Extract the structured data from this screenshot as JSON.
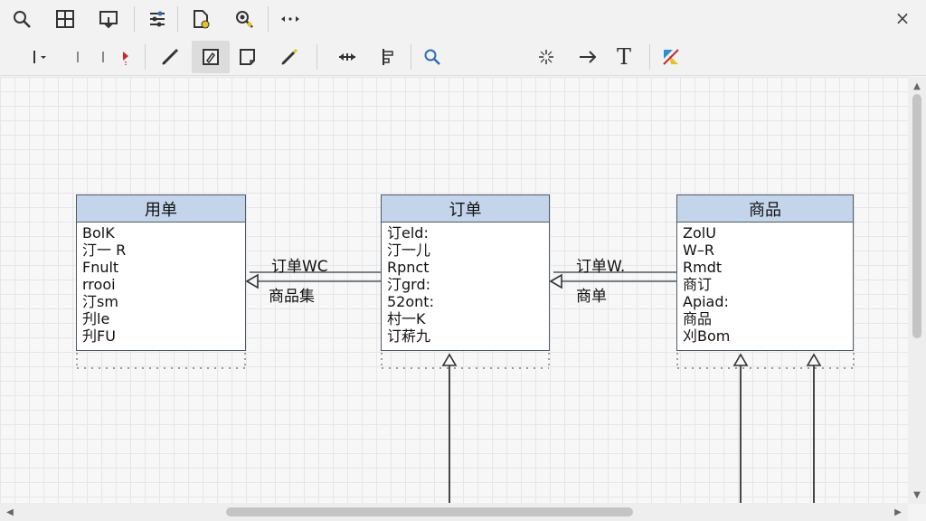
{
  "toolbar": {
    "close_label": "×",
    "top_icons": [
      "zoom-icon",
      "table-icon",
      "export-icon",
      "settings-icon",
      "document-icon",
      "zoom-settings-icon",
      "connector-icon"
    ],
    "second_icons": [
      "line-style-icon",
      "line-end-icon",
      "line-arrow-icon",
      "pencil-icon",
      "shape-edit-icon",
      "shape-icon",
      "pen-icon",
      "move-icon",
      "align-icon",
      "search-icon",
      "snap-icon",
      "arrow-icon",
      "text-icon",
      "color-icon"
    ],
    "text_tool_label": "T"
  },
  "entities": [
    {
      "title": "用单",
      "fields": [
        "BolK",
        "汀一 R",
        "Fnult",
        "rrooi",
        "汀sm",
        "刋le",
        "刋FU"
      ]
    },
    {
      "title": "订单",
      "fields": [
        "订eld:",
        "汀一儿",
        "Rpnct",
        "汀grd:",
        "52ont:",
        "村一K",
        "订菥九"
      ]
    },
    {
      "title": "商品",
      "fields": [
        "ZolU",
        "W–R",
        "Rmdt",
        "商订",
        "Apiad:",
        "商品",
        "刈Bom"
      ]
    }
  ],
  "relations": [
    {
      "top": "订单WC",
      "bottom": "商品集"
    },
    {
      "top": "订单W.",
      "bottom": "商单"
    }
  ],
  "colors": {
    "header_fill": "#c3d5ea",
    "border": "#505a66",
    "accent_blue": "#2a6fb8"
  }
}
